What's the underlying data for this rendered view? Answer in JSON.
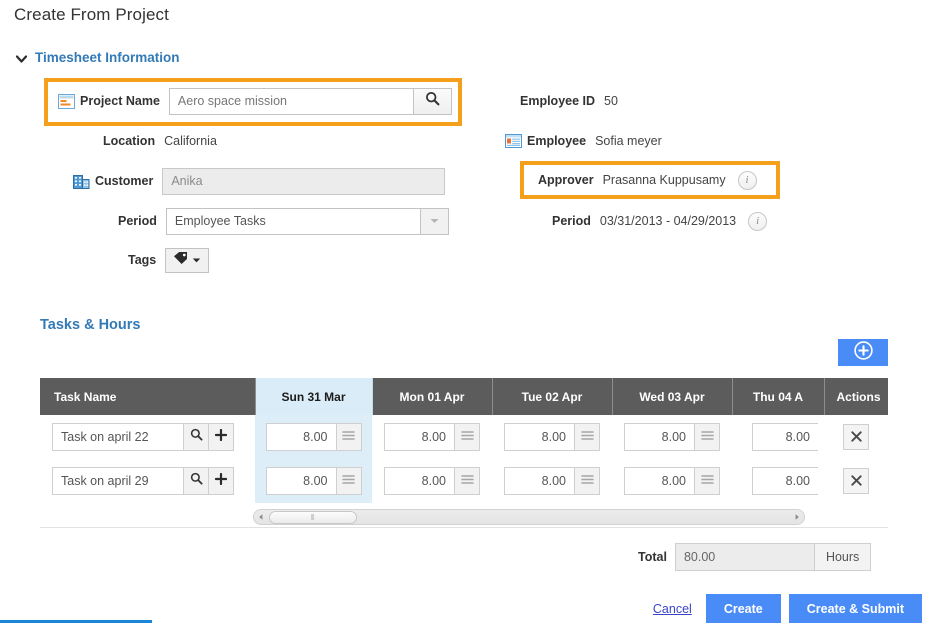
{
  "page": {
    "title": "Create From Project"
  },
  "sections": {
    "timesheet": {
      "label": "Timesheet Information",
      "chevron": "chevron-down-icon"
    },
    "tasks": {
      "label": "Tasks & Hours"
    }
  },
  "form": {
    "project_name": {
      "label": "Project Name",
      "icon": "project-icon",
      "value": "Aero space mission",
      "search_icon": "search-icon"
    },
    "location": {
      "label": "Location",
      "value": "California"
    },
    "customer": {
      "label": "Customer",
      "icon": "building-icon",
      "value": "Anika"
    },
    "period_select": {
      "label": "Period",
      "value": "Employee Tasks",
      "dropdown_icon": "chevron-down-icon",
      "options": [
        "Employee Tasks"
      ]
    },
    "tags": {
      "label": "Tags",
      "icon": "tag-icon",
      "dropdown_icon": "chevron-down-icon"
    },
    "employee_id": {
      "label": "Employee ID",
      "value": "50"
    },
    "employee": {
      "label": "Employee",
      "icon": "id-card-icon",
      "value": "Sofia meyer"
    },
    "approver": {
      "label": "Approver",
      "value": "Prasanna Kuppusamy",
      "info_icon": "info-icon"
    },
    "period_range": {
      "label": "Period",
      "value": "03/31/2013 - 04/29/2013",
      "info_icon": "info-icon"
    }
  },
  "table": {
    "add_button": {
      "name": "add-row-button",
      "icon": "plus-circle-icon"
    },
    "columns": [
      {
        "label": "Task Name",
        "selected": false
      },
      {
        "label": "Sun 31 Mar",
        "selected": true
      },
      {
        "label": "Mon 01 Apr",
        "selected": false
      },
      {
        "label": "Tue 02 Apr",
        "selected": false
      },
      {
        "label": "Wed 03 Apr",
        "selected": false
      },
      {
        "label": "Thu 04 A",
        "selected": false
      },
      {
        "label": "Actions",
        "selected": false
      }
    ],
    "rows": [
      {
        "task_name": "Task on april 22",
        "search_icon": "search-icon",
        "add_icon": "plus-icon",
        "hours": [
          "8.00",
          "8.00",
          "8.00",
          "8.00",
          "8.00"
        ],
        "delete_icon": "close-icon"
      },
      {
        "task_name": "Task on april 29",
        "search_icon": "search-icon",
        "add_icon": "plus-icon",
        "hours": [
          "8.00",
          "8.00",
          "8.00",
          "8.00",
          "8.00"
        ],
        "delete_icon": "close-icon"
      }
    ],
    "scrollbar": {
      "left_arrow": "caret-left-icon",
      "right_arrow": "caret-right-icon",
      "grip": "‖"
    }
  },
  "total": {
    "label": "Total",
    "value": "80.00",
    "unit": "Hours"
  },
  "footer": {
    "cancel": "Cancel",
    "create": "Create",
    "create_submit": "Create & Submit"
  },
  "colors": {
    "accent_blue": "#4a8cf7",
    "link_blue": "#337ab7",
    "highlight_orange": "#f5a01d",
    "header_gray": "#5c5c5c",
    "selected_column": "#ddeef8",
    "progress_blue": "#1a86d8"
  }
}
